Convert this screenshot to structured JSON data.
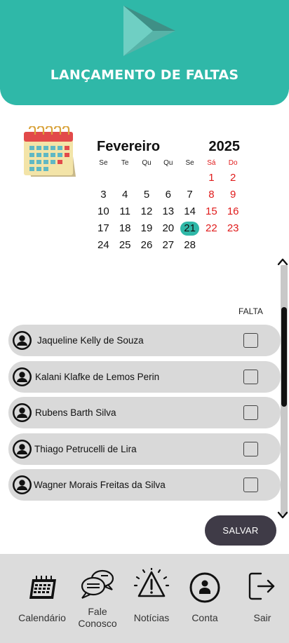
{
  "header": {
    "title": "LANÇAMENTO DE FALTAS",
    "brand_color": "#2fb8a8"
  },
  "calendar": {
    "month": "Fevereiro",
    "year": "2025",
    "weekdays": [
      "Se",
      "Te",
      "Qu",
      "Qu",
      "Se",
      "Sá",
      "Do"
    ],
    "weeks": [
      [
        "",
        "",
        "",
        "",
        "",
        "1",
        "2"
      ],
      [
        "3",
        "4",
        "5",
        "6",
        "7",
        "8",
        "9"
      ],
      [
        "10",
        "11",
        "12",
        "13",
        "14",
        "15",
        "16"
      ],
      [
        "17",
        "18",
        "19",
        "20",
        "21",
        "22",
        "23"
      ],
      [
        "24",
        "25",
        "26",
        "27",
        "28",
        "",
        ""
      ]
    ],
    "selected_day": "21",
    "weekend_color": "#e01b1b"
  },
  "list": {
    "falta_header": "FALTA",
    "students": [
      {
        "name": "Jaqueline Kelly de Souza",
        "falta": false
      },
      {
        "name": "Kalani Klafke de Lemos Perin",
        "falta": false
      },
      {
        "name": "Rubens Barth Silva",
        "falta": false
      },
      {
        "name": "Thiago Petrucelli de Lira",
        "falta": false
      },
      {
        "name": "Wagner Morais Freitas da Silva",
        "falta": false
      }
    ]
  },
  "actions": {
    "save_label": "SALVAR"
  },
  "nav": {
    "items": [
      {
        "label": "Calendário",
        "icon": "calendar-icon"
      },
      {
        "label": "Fale\nConosco",
        "icon": "chat-bubbles-icon"
      },
      {
        "label": "Notícias",
        "icon": "alert-icon"
      },
      {
        "label": "Conta",
        "icon": "account-icon"
      },
      {
        "label": "Sair",
        "icon": "logout-icon"
      }
    ]
  }
}
